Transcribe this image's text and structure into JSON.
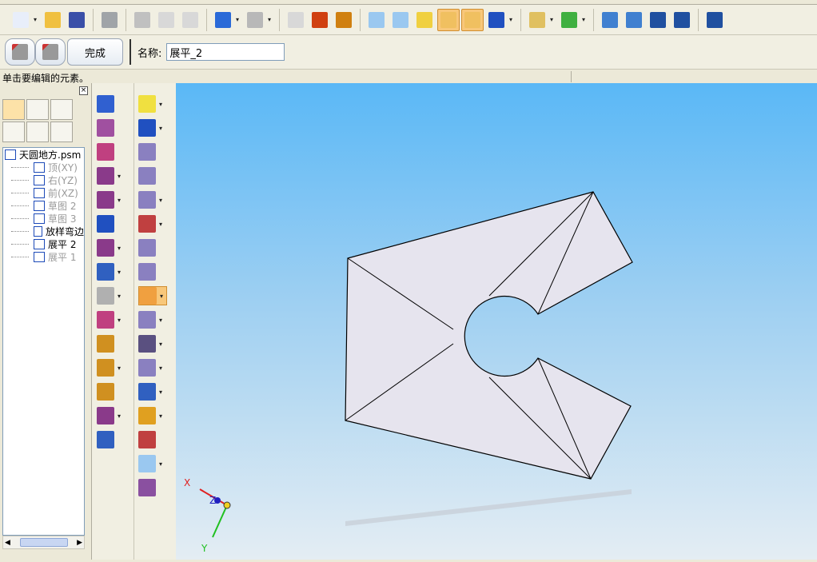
{
  "toolbar": {
    "buttons": [
      {
        "name": "new-file-icon",
        "color": "#e8eefa",
        "dd": true
      },
      {
        "name": "open-folder-icon",
        "color": "#f0c040"
      },
      {
        "name": "save-icon",
        "color": "#3a4fa8"
      },
      {
        "sep": true
      },
      {
        "name": "print-icon",
        "color": "#a0a4a8"
      },
      {
        "sep": true
      },
      {
        "name": "cut-icon",
        "color": "#c0c0c0"
      },
      {
        "name": "copy-icon",
        "color": "#d8d8d8"
      },
      {
        "name": "paste-icon",
        "color": "#d8d8d8"
      },
      {
        "sep": true
      },
      {
        "name": "undo-icon",
        "color": "#2a6ad8",
        "dd": true
      },
      {
        "name": "redo-icon",
        "color": "#b8b8b8",
        "dd": true
      },
      {
        "sep": true
      },
      {
        "name": "paste-special-icon",
        "color": "#d8d8d8"
      },
      {
        "name": "insert-part-icon",
        "color": "#d04010"
      },
      {
        "name": "insert-assembly-icon",
        "color": "#d08010"
      },
      {
        "sep": true
      },
      {
        "name": "wireframe-view-icon",
        "color": "#9ac8f0"
      },
      {
        "name": "hidden-line-view-icon",
        "color": "#9ac8f0"
      },
      {
        "name": "shaded-view-icon",
        "color": "#f0d040"
      },
      {
        "name": "shaded-edges-view-icon",
        "color": "#f0c060",
        "on": true
      },
      {
        "name": "smooth-shaded-view-icon",
        "color": "#f0c060",
        "on": true
      },
      {
        "name": "view-orientation-icon",
        "color": "#2050c0",
        "dd": true
      },
      {
        "sep": true
      },
      {
        "name": "layer-icon",
        "color": "#e0c060",
        "dd": true
      },
      {
        "name": "rotate-view-icon",
        "color": "#40b040",
        "dd": true
      },
      {
        "sep": true
      },
      {
        "name": "zoom-area-icon",
        "color": "#4080d0"
      },
      {
        "name": "zoom-icon",
        "color": "#4080d0"
      },
      {
        "name": "fit-icon",
        "color": "#2050a0"
      },
      {
        "name": "pan-icon",
        "color": "#2050a0"
      },
      {
        "sep": true
      },
      {
        "name": "help-icon",
        "color": "#2050a0"
      }
    ]
  },
  "command_bar": {
    "done_label": "完成",
    "name_label": "名称:",
    "name_value": "展平_2"
  },
  "status": "单击要编辑的元素。",
  "tree": {
    "items": [
      {
        "label": "天圆地方.psm",
        "dim": false,
        "root": true
      },
      {
        "label": "顶(XY)",
        "dim": true
      },
      {
        "label": "右(YZ)",
        "dim": true
      },
      {
        "label": "前(XZ)",
        "dim": true
      },
      {
        "label": "草图 2",
        "dim": true
      },
      {
        "label": "草图 3",
        "dim": true
      },
      {
        "label": "放样弯边",
        "dim": false
      },
      {
        "label": "展平 2",
        "dim": false
      },
      {
        "label": "展平 1",
        "dim": true
      }
    ]
  },
  "col1": [
    {
      "name": "tab-icon",
      "color": "#3060d0"
    },
    {
      "name": "contour-flange-icon",
      "color": "#a050a0"
    },
    {
      "name": "lofted-flange-icon",
      "color": "#c04080"
    },
    {
      "name": "flange-icon",
      "color": "#8a3a8a",
      "dd": true
    },
    {
      "name": "hem-icon",
      "color": "#8a3a8a",
      "dd": true
    },
    {
      "name": "hole-icon",
      "color": "#2050c0"
    },
    {
      "name": "cutout-icon",
      "color": "#8a3a8a",
      "dd": true
    },
    {
      "name": "normal-cutout-icon",
      "color": "#3060c0",
      "dd": true
    },
    {
      "name": "louver-icon",
      "color": "#b0b0b0",
      "dd": true
    },
    {
      "name": "break-corner-icon",
      "color": "#c04080",
      "dd": true
    },
    {
      "name": "bend-icon",
      "color": "#d09020"
    },
    {
      "name": "unbend-icon",
      "color": "#d09020",
      "dd": true
    },
    {
      "name": "rebend-icon",
      "color": "#d09020"
    },
    {
      "name": "jog-icon",
      "color": "#8a3a8a",
      "dd": true
    },
    {
      "name": "convert-icon",
      "color": "#3060c0"
    }
  ],
  "col2": [
    {
      "name": "select-icon",
      "color": "#f0e040",
      "dd": true
    },
    {
      "name": "sketch-icon",
      "color": "#2050c0",
      "dd": true
    },
    {
      "name": "face-icon",
      "color": "#8a80c0"
    },
    {
      "name": "extrude-icon",
      "color": "#8a80c0"
    },
    {
      "name": "sweep-icon",
      "color": "#8a80c0",
      "dd": true
    },
    {
      "name": "draw-icon",
      "color": "#c04040",
      "dd": true
    },
    {
      "name": "mirror-icon",
      "color": "#8a80c0"
    },
    {
      "name": "move-face-icon",
      "color": "#8a80c0"
    },
    {
      "name": "flatten-icon",
      "color": "#f0a040",
      "dd": true,
      "on": true
    },
    {
      "name": "thicken-icon",
      "color": "#8a80c0",
      "dd": true
    },
    {
      "name": "thin-wall-icon",
      "color": "#5a5080",
      "dd": true
    },
    {
      "name": "pattern-icon",
      "color": "#8a80c0",
      "dd": true
    },
    {
      "name": "fillet-icon",
      "color": "#3060c0",
      "dd": true
    },
    {
      "name": "split-icon",
      "color": "#e0a020",
      "dd": true
    },
    {
      "name": "coordinate-system-icon",
      "color": "#c04040"
    },
    {
      "name": "plane-icon",
      "color": "#9ac8f0",
      "dd": true
    },
    {
      "name": "part-body-icon",
      "color": "#8a50a0"
    }
  ],
  "axes": {
    "x": "X",
    "y": "Y",
    "z": "Z",
    "x_color": "#e02020",
    "y_color": "#20c020",
    "z_color": "#2020c0"
  },
  "model_color": "#e6e4ee"
}
